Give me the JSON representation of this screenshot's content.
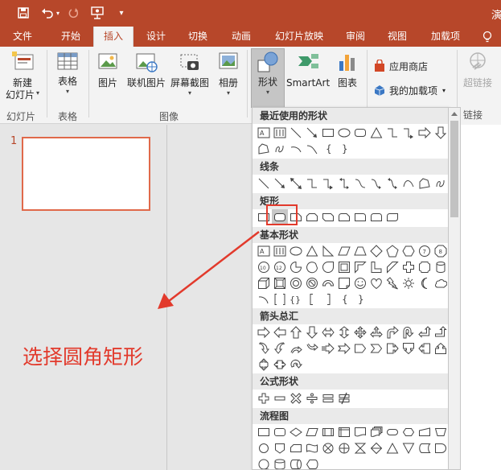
{
  "title_fragment": "演",
  "tabs": [
    {
      "label": "文件",
      "active": false
    },
    {
      "label": "开始",
      "active": false
    },
    {
      "label": "插入",
      "active": true
    },
    {
      "label": "设计",
      "active": false
    },
    {
      "label": "切换",
      "active": false
    },
    {
      "label": "动画",
      "active": false
    },
    {
      "label": "幻灯片放映",
      "active": false
    },
    {
      "label": "审阅",
      "active": false
    },
    {
      "label": "视图",
      "active": false
    },
    {
      "label": "加载项",
      "active": false
    }
  ],
  "ribbon": {
    "new_slide": {
      "line1": "新建",
      "line2": "幻灯片"
    },
    "table": {
      "label": "表格"
    },
    "picture": {
      "label": "图片"
    },
    "online_picture": {
      "label": "联机图片"
    },
    "screenshot": {
      "label": "屏幕截图"
    },
    "album": {
      "label": "相册"
    },
    "shapes": {
      "label": "形状"
    },
    "smartart": {
      "label": "SmartArt"
    },
    "chart": {
      "label": "图表"
    },
    "store": {
      "label": "应用商店"
    },
    "my_addins": {
      "label": "我的加载项"
    },
    "hyperlink": {
      "label": "超链接"
    },
    "groups": {
      "slides": "幻灯片",
      "tables": "表格",
      "images": "图像",
      "links": "链接"
    }
  },
  "slide_panel": {
    "slide_number": "1"
  },
  "dropdown": {
    "sections": [
      "最近使用的形状",
      "线条",
      "矩形",
      "基本形状",
      "箭头总汇",
      "公式形状",
      "流程图"
    ]
  },
  "annotation": {
    "text": "选择圆角矩形",
    "color": "#e23a2c"
  },
  "colors": {
    "accent": "#b7472a",
    "highlight": "#e23a2c"
  }
}
